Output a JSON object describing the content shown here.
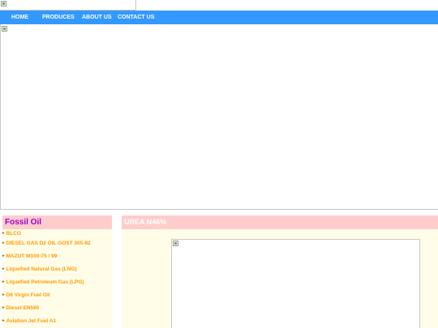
{
  "nav": {
    "items": [
      {
        "label": "HOME"
      },
      {
        "label": "PRODUCES"
      },
      {
        "label": "ABOUT US"
      },
      {
        "label": "CONTACT US"
      }
    ]
  },
  "left_panel": {
    "title": "Fossil Oil",
    "items": [
      {
        "label": "BLCO"
      },
      {
        "label": "DIESEL GAS D2 OIL GOST 305-82"
      },
      {
        "label": "MAZUT M100-75 / 99"
      },
      {
        "label": "Liquefied Natural Gas (LNG)"
      },
      {
        "label": "Liquefied Petroleum Gas (LPG)"
      },
      {
        "label": "D6 Virgin Fuel Oil"
      },
      {
        "label": "Diesel EN590"
      },
      {
        "label": "Aviation Jet Fuel A1"
      }
    ]
  },
  "right_panel": {
    "title": "UREA N46%"
  },
  "colors": {
    "nav_bg": "#3399ff",
    "panel_header": "#ffcccc",
    "panel_bg": "#fffde8",
    "left_title": "#9900cc",
    "link": "#ff9900"
  },
  "icons": {
    "broken_image": "broken-image-icon",
    "bullet": "bullet-icon"
  }
}
